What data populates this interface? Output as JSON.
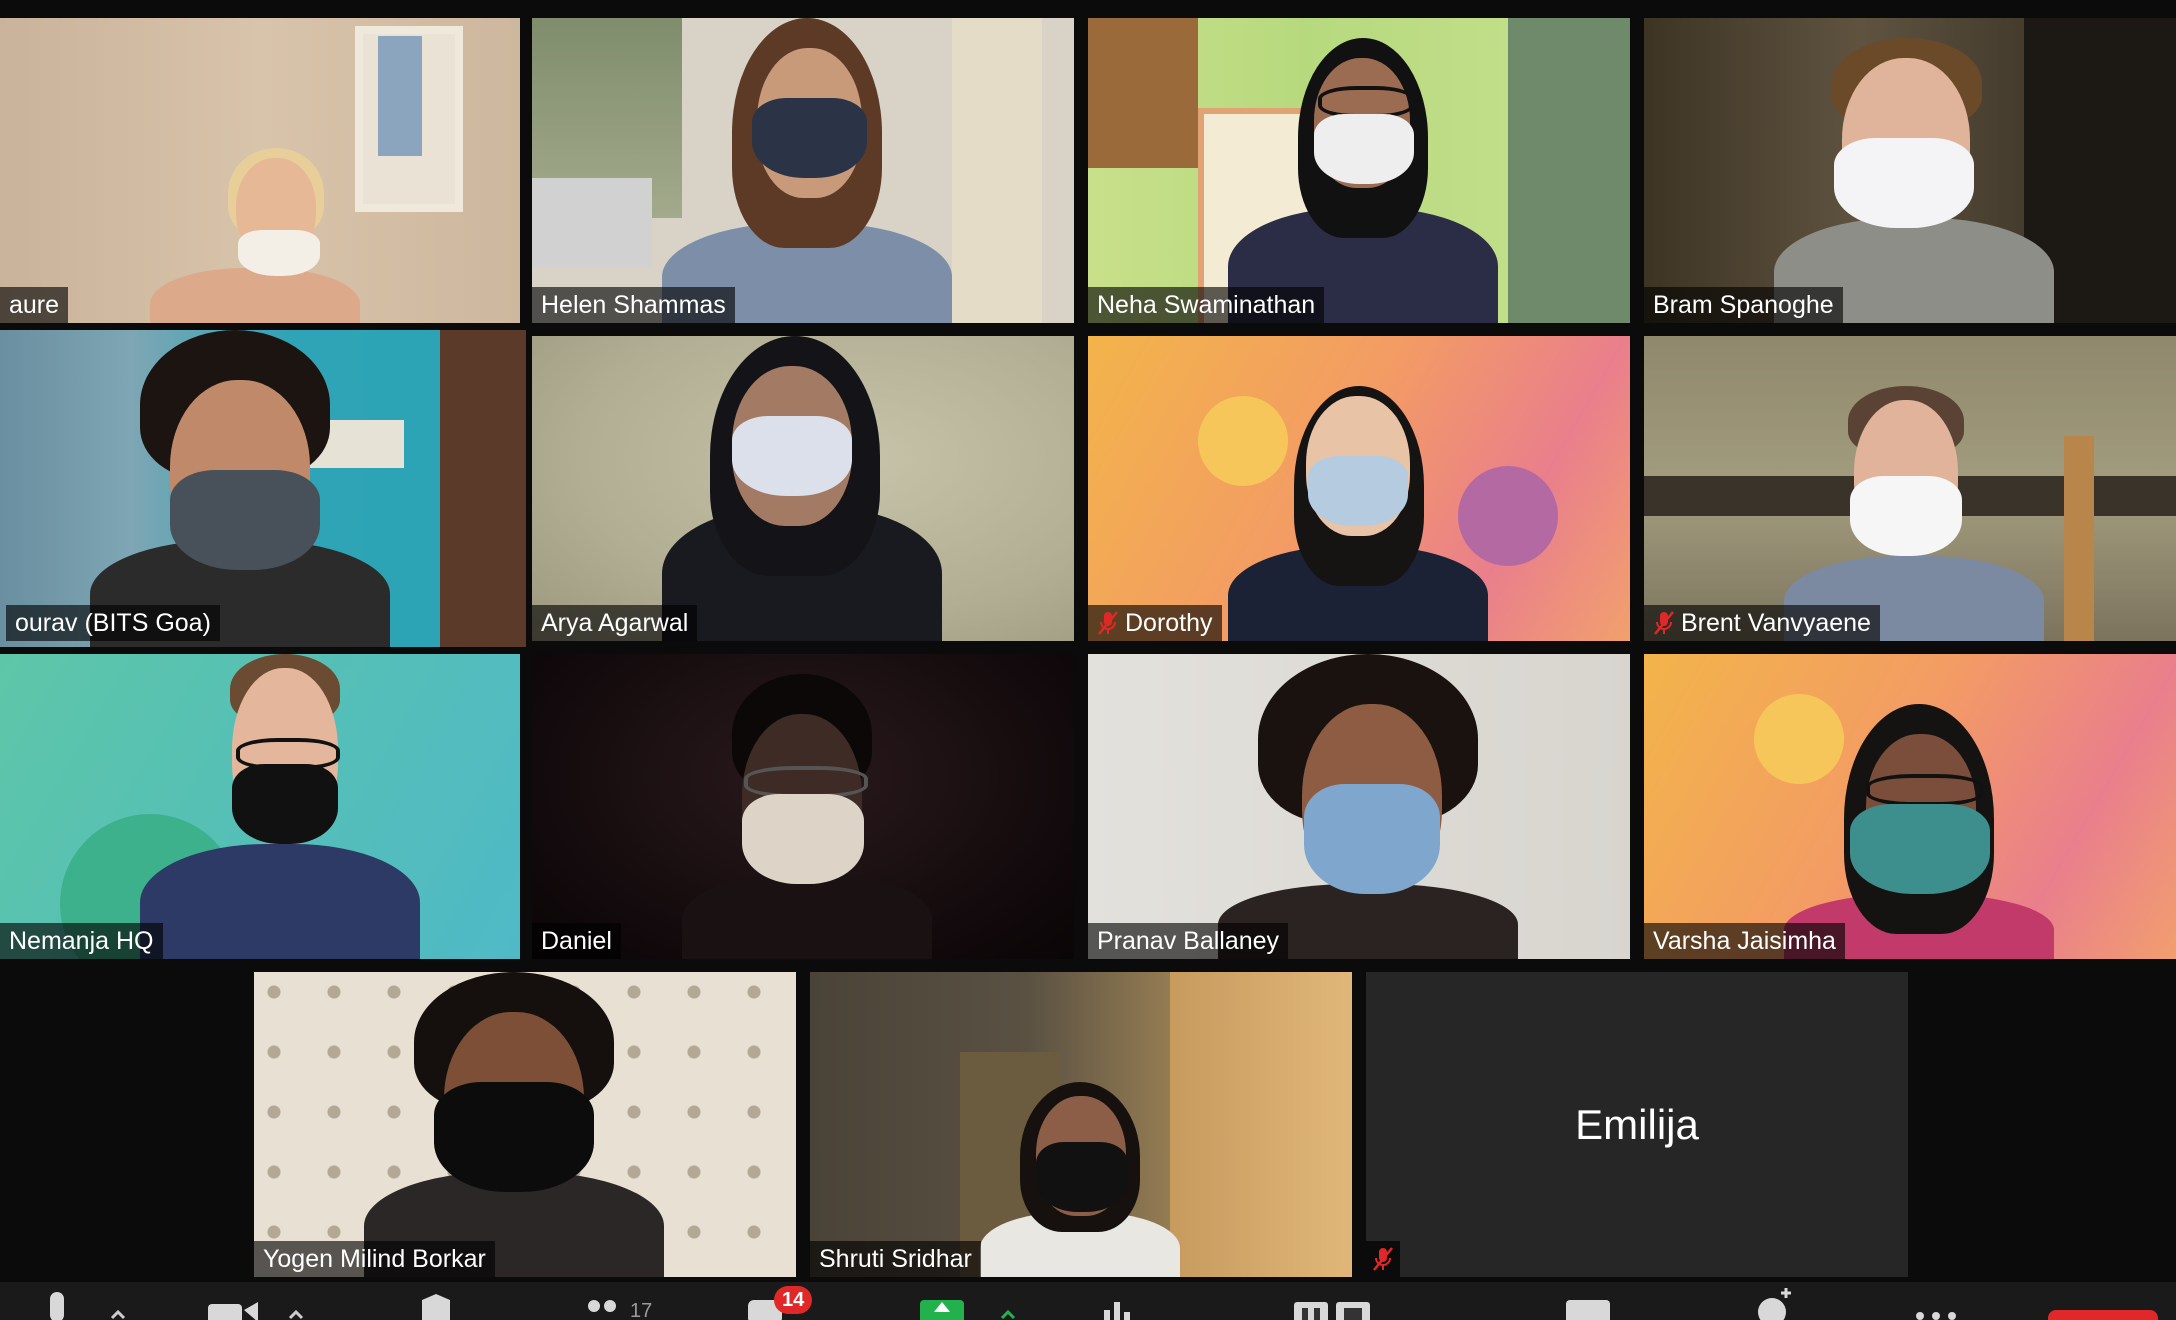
{
  "participants": [
    {
      "name": "aure",
      "muted": false
    },
    {
      "name": "Helen Shammas",
      "muted": false
    },
    {
      "name": "Neha Swaminathan",
      "muted": false
    },
    {
      "name": "Bram Spanoghe",
      "muted": false
    },
    {
      "name": "ourav (BITS Goa)",
      "muted": false,
      "active_speaker": true
    },
    {
      "name": "Arya Agarwal",
      "muted": false
    },
    {
      "name": "Dorothy",
      "muted": true
    },
    {
      "name": "Brent Vanvyaene",
      "muted": true
    },
    {
      "name": "Nemanja HQ",
      "muted": true
    },
    {
      "name": "Daniel",
      "muted": false
    },
    {
      "name": "Pranav Ballaney",
      "muted": false
    },
    {
      "name": "Varsha Jaisimha",
      "muted": false
    },
    {
      "name": "Yogen Milind Borkar",
      "muted": false
    },
    {
      "name": "Shruti Sridhar",
      "muted": false
    },
    {
      "name": "Emilija",
      "muted": true,
      "video_off": true
    }
  ],
  "toolbar": {
    "participants_count": "17",
    "chat_badge": "14",
    "items": [
      "mic-icon",
      "video-icon",
      "security-icon",
      "participants-icon",
      "chat-icon",
      "share-screen-icon",
      "polls-icon",
      "record-icon",
      "captions-icon",
      "reactions-icon",
      "more-icon",
      "end-button"
    ]
  },
  "colors": {
    "active_speaker_border": "#e6e388",
    "muted_icon": "#e02828",
    "share_green": "#23b14d",
    "end_red": "#e02828"
  }
}
